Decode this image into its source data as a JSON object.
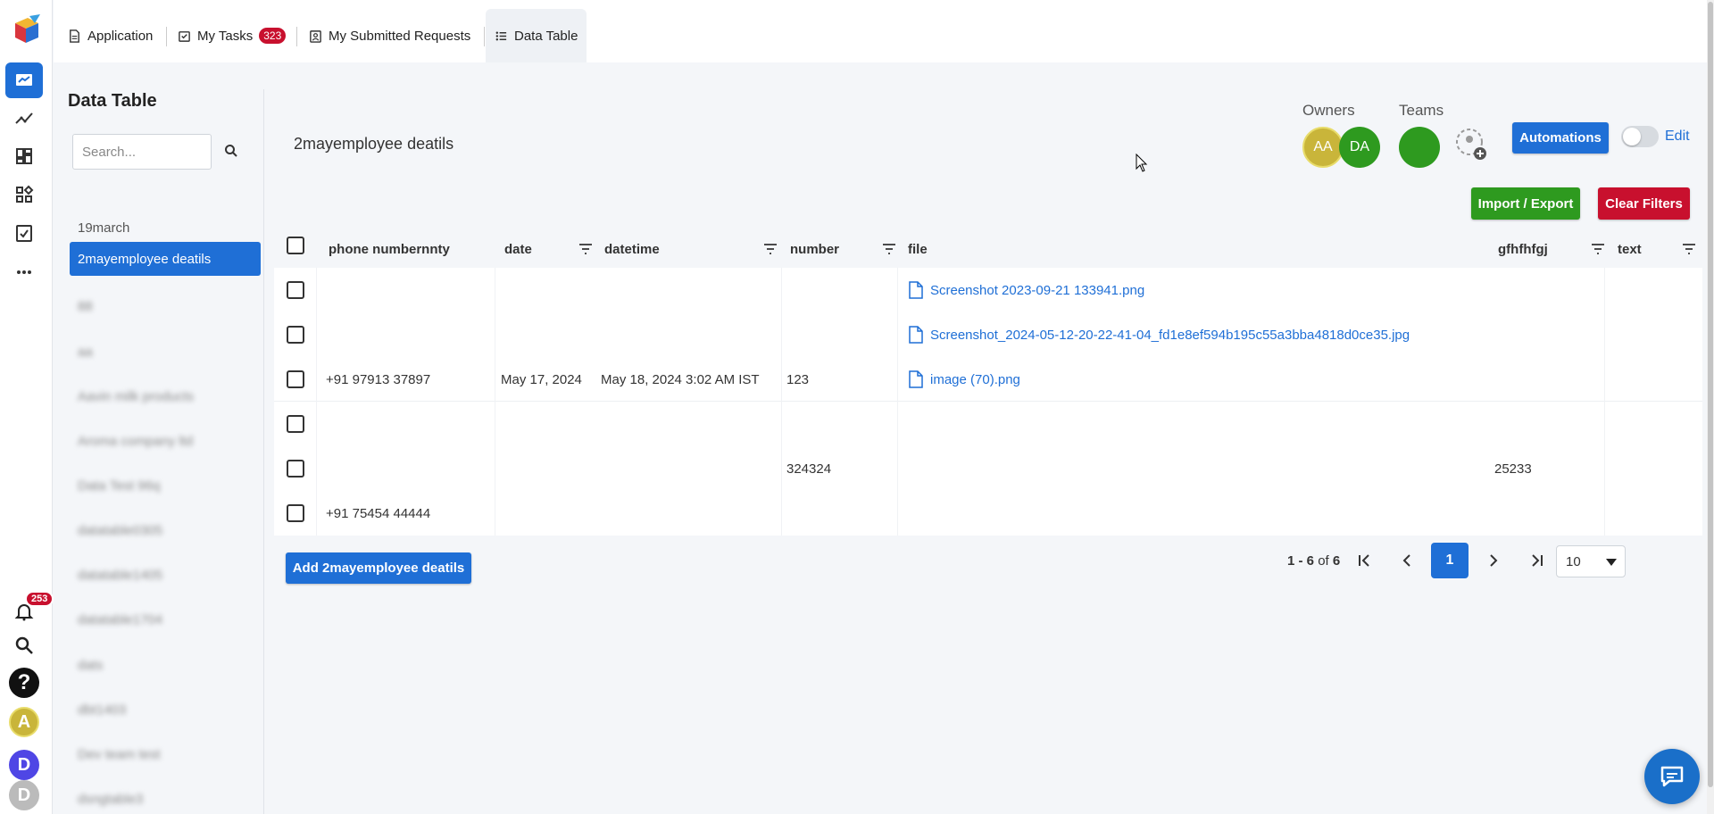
{
  "topbar": {
    "tabs": [
      {
        "label": "Application",
        "icon": "document-icon"
      },
      {
        "label": "My Tasks",
        "icon": "task-icon",
        "badge": "323"
      },
      {
        "label": "My Submitted Requests",
        "icon": "badge-icon"
      },
      {
        "label": "Data Table",
        "icon": "grid-icon",
        "active": true
      }
    ]
  },
  "rail": {
    "items": [
      "home-icon",
      "analytics-icon",
      "dashboard-icon",
      "widgets-icon",
      "approval-icon",
      "more-icon"
    ],
    "notification_badge": "253",
    "avatars": [
      "A",
      "D",
      "D"
    ]
  },
  "sidebar": {
    "title": "Data Table",
    "search_placeholder": "Search...",
    "items": [
      "19march",
      "2mayemployee deatils",
      "88",
      "aa",
      "Aavin milk products",
      "Aroma company ltd",
      "Data Test 96q",
      "datatable0305",
      "datatable1405",
      "datatable1704",
      "dats",
      "dbt1403",
      "Dev team test",
      "dsngtable3"
    ],
    "active_index": 1
  },
  "header": {
    "title": "2mayemployee deatils",
    "owners_label": "Owners",
    "teams_label": "Teams",
    "owner_avatars": [
      "AA",
      "DA"
    ],
    "automations_label": "Automations",
    "edit_label": "Edit",
    "import_export_label": "Import / Export",
    "clear_filters_label": "Clear Filters"
  },
  "table": {
    "columns": [
      "phone numbernnty",
      "date",
      "datetime",
      "number",
      "file",
      "gfhfhfgj",
      "text"
    ],
    "rows": [
      {
        "phone": "",
        "date": "",
        "datetime": "",
        "number": "",
        "file": "Screenshot 2023-09-21 133941.png",
        "gfhfhfgj": "",
        "text": ""
      },
      {
        "phone": "",
        "date": "",
        "datetime": "",
        "number": "",
        "file": "Screenshot_2024-05-12-20-22-41-04_fd1e8ef594b195c55a3bba4818d0ce35.jpg",
        "gfhfhfgj": "",
        "text": ""
      },
      {
        "phone": "+91 97913 37897",
        "date": "May 17, 2024",
        "datetime": "May 18, 2024 3:02 AM IST",
        "number": "123",
        "file": "image (70).png",
        "gfhfhfgj": "",
        "text": ""
      },
      {
        "phone": "",
        "date": "",
        "datetime": "",
        "number": "",
        "file": "",
        "gfhfhfgj": "",
        "text": ""
      },
      {
        "phone": "",
        "date": "",
        "datetime": "",
        "number": "324324",
        "file": "",
        "gfhfhfgj": "25233",
        "text": ""
      },
      {
        "phone": "+91 75454 44444",
        "date": "",
        "datetime": "",
        "number": "",
        "file": "",
        "gfhfhfgj": "",
        "text": ""
      }
    ],
    "add_button_label": "Add 2mayemployee deatils"
  },
  "pagination": {
    "range": "1 - 6",
    "of_label": "of",
    "total": "6",
    "current_page": "1",
    "page_size": "10"
  },
  "colors": {
    "primary": "#1f6fd6",
    "success": "#2e9a1f",
    "danger": "#c8102e"
  }
}
